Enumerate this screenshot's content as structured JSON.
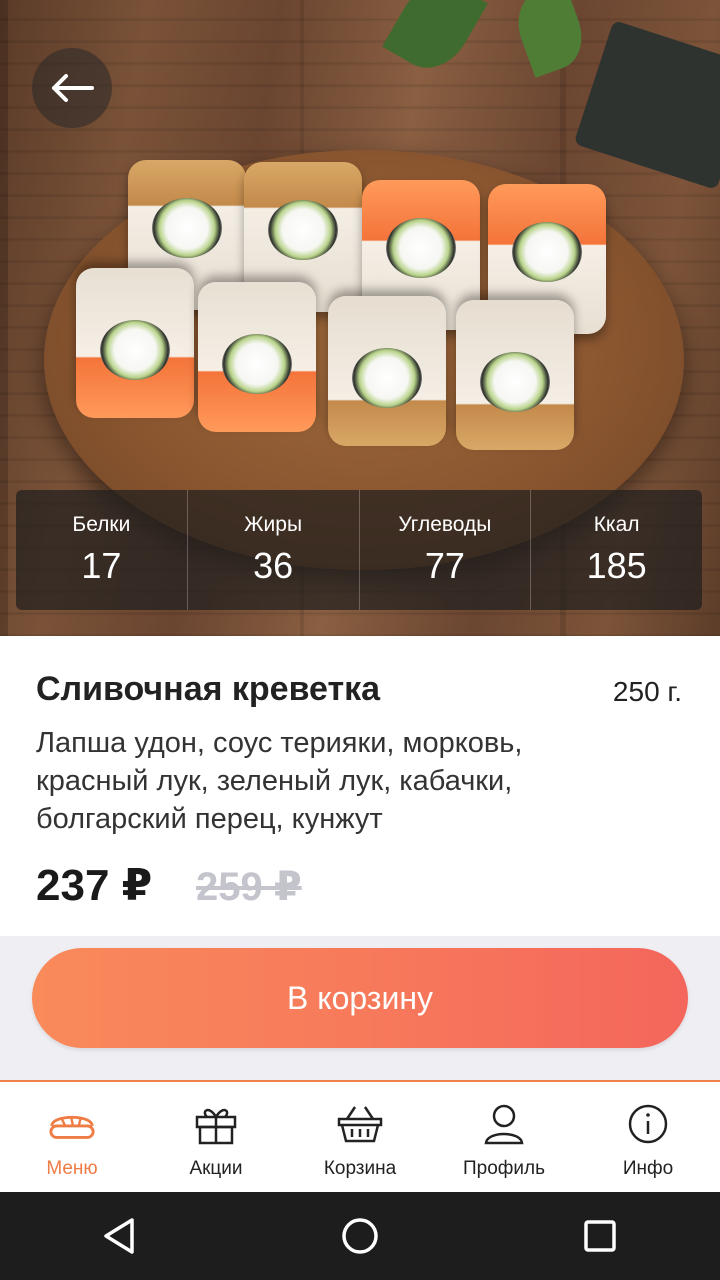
{
  "product": {
    "name": "Сливочная креветка",
    "weight": "250 г.",
    "description": "Лапша удон, соус терияки, морковь, красный лук, зеленый лук, кабачки, болгарский перец, кунжут",
    "price": "237 ₽",
    "old_price": "259 ₽"
  },
  "nutrition": [
    {
      "label": "Белки",
      "value": "17"
    },
    {
      "label": "Жиры",
      "value": "36"
    },
    {
      "label": "Углеводы",
      "value": "77"
    },
    {
      "label": "Ккал",
      "value": "185"
    }
  ],
  "actions": {
    "add_to_cart": "В корзину"
  },
  "bottom_nav": [
    {
      "label": "Меню",
      "icon": "sushi-icon",
      "active": true
    },
    {
      "label": "Акции",
      "icon": "gift-icon",
      "active": false
    },
    {
      "label": "Корзина",
      "icon": "basket-icon",
      "active": false
    },
    {
      "label": "Профиль",
      "icon": "user-icon",
      "active": false
    },
    {
      "label": "Инфо",
      "icon": "info-icon",
      "active": false
    }
  ],
  "colors": {
    "accent": "#f07c45",
    "button_start": "#f98a5a",
    "button_end": "#f4665b",
    "old_price": "#c4c4cc"
  }
}
